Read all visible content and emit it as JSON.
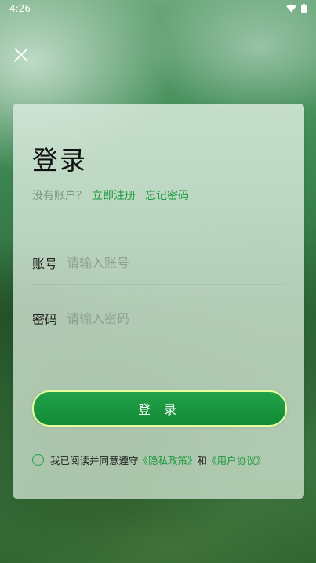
{
  "status_bar": {
    "time": "4:26"
  },
  "login": {
    "title": "登录",
    "no_account_text": "没有账户？",
    "register_link": "立即注册",
    "forgot_link": "忘记密码",
    "account_label": "账号",
    "account_placeholder": "请输入账号",
    "password_label": "密码",
    "password_placeholder": "请输入密码",
    "submit_label": "登 录",
    "agreement": {
      "prefix": "我已阅读并同意遵守",
      "privacy_link": "《隐私政策》",
      "and": "和",
      "user_agreement_link": "《用户协议》",
      "checked": false
    }
  },
  "colors": {
    "accent": "#1a9a3d",
    "button_border": "#e6ff9c"
  },
  "icons": {
    "close": "close-icon",
    "wifi": "wifi-icon",
    "battery": "battery-icon"
  }
}
